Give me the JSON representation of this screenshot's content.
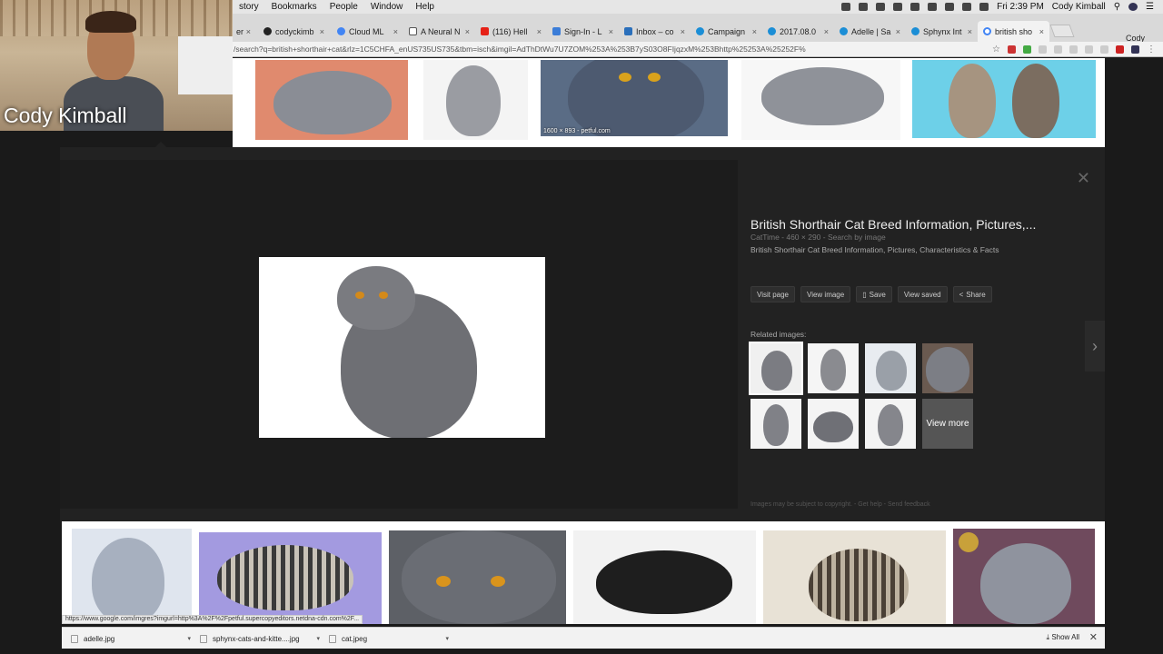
{
  "menubar": {
    "items": [
      "story",
      "Bookmarks",
      "People",
      "Window",
      "Help"
    ],
    "clock": "Fri 2:39 PM",
    "user": "Cody Kimball"
  },
  "tabs": [
    {
      "label": "er",
      "color": "#888"
    },
    {
      "label": "codyckimb",
      "color": "#222"
    },
    {
      "label": "Cloud ML",
      "color": "#4285f4"
    },
    {
      "label": "A Neural N",
      "color": "#555"
    },
    {
      "label": "(116) Hell",
      "color": "#e62117"
    },
    {
      "label": "Sign-In - L",
      "color": "#3b7dd8"
    },
    {
      "label": "Inbox – co",
      "color": "#2a6fbb"
    },
    {
      "label": "Campaign",
      "color": "#1b8ed6"
    },
    {
      "label": "2017.08.0",
      "color": "#1b8ed6"
    },
    {
      "label": "Adelle | Sa",
      "color": "#1b8ed6"
    },
    {
      "label": "Sphynx Int",
      "color": "#1b8ed6"
    },
    {
      "label": "british sho",
      "color": "#4285f4"
    }
  ],
  "profile_name": "Cody",
  "address": {
    "url": "/search?q=british+shorthair+cat&rlz=1C5CHFA_enUS735US735&tbm=isch&imgil=AdThDtWu7U7ZOM%253A%253B7yS03O8FIjqzxM%253Bhttp%25253A%25252F%"
  },
  "webcam": {
    "name": "Cody Kimball"
  },
  "top_thumb_caption": "1600 × 893 - petful.com",
  "preview": {
    "title": "British Shorthair Cat Breed Information, Pictures,...",
    "meta": "CatTime - 460 × 290 - Search by image",
    "description": "British Shorthair Cat Breed Information, Pictures, Characteristics & Facts",
    "actions": [
      "Visit page",
      "View image",
      "Save",
      "View saved",
      "Share"
    ],
    "related_label": "Related images:",
    "view_more": "View more",
    "footer": "Images may be subject to copyright. - Get help - Send feedback"
  },
  "status_url": "https://www.google.com/imgres?imgurl=http%3A%2F%2Fpetful.supercopyeditors.netdna-cdn.com%2F...",
  "downloads": [
    {
      "name": "adelle.jpg"
    },
    {
      "name": "sphynx-cats-and-kitte....jpg"
    },
    {
      "name": "cat.jpeg"
    }
  ],
  "show_all": "Show All"
}
